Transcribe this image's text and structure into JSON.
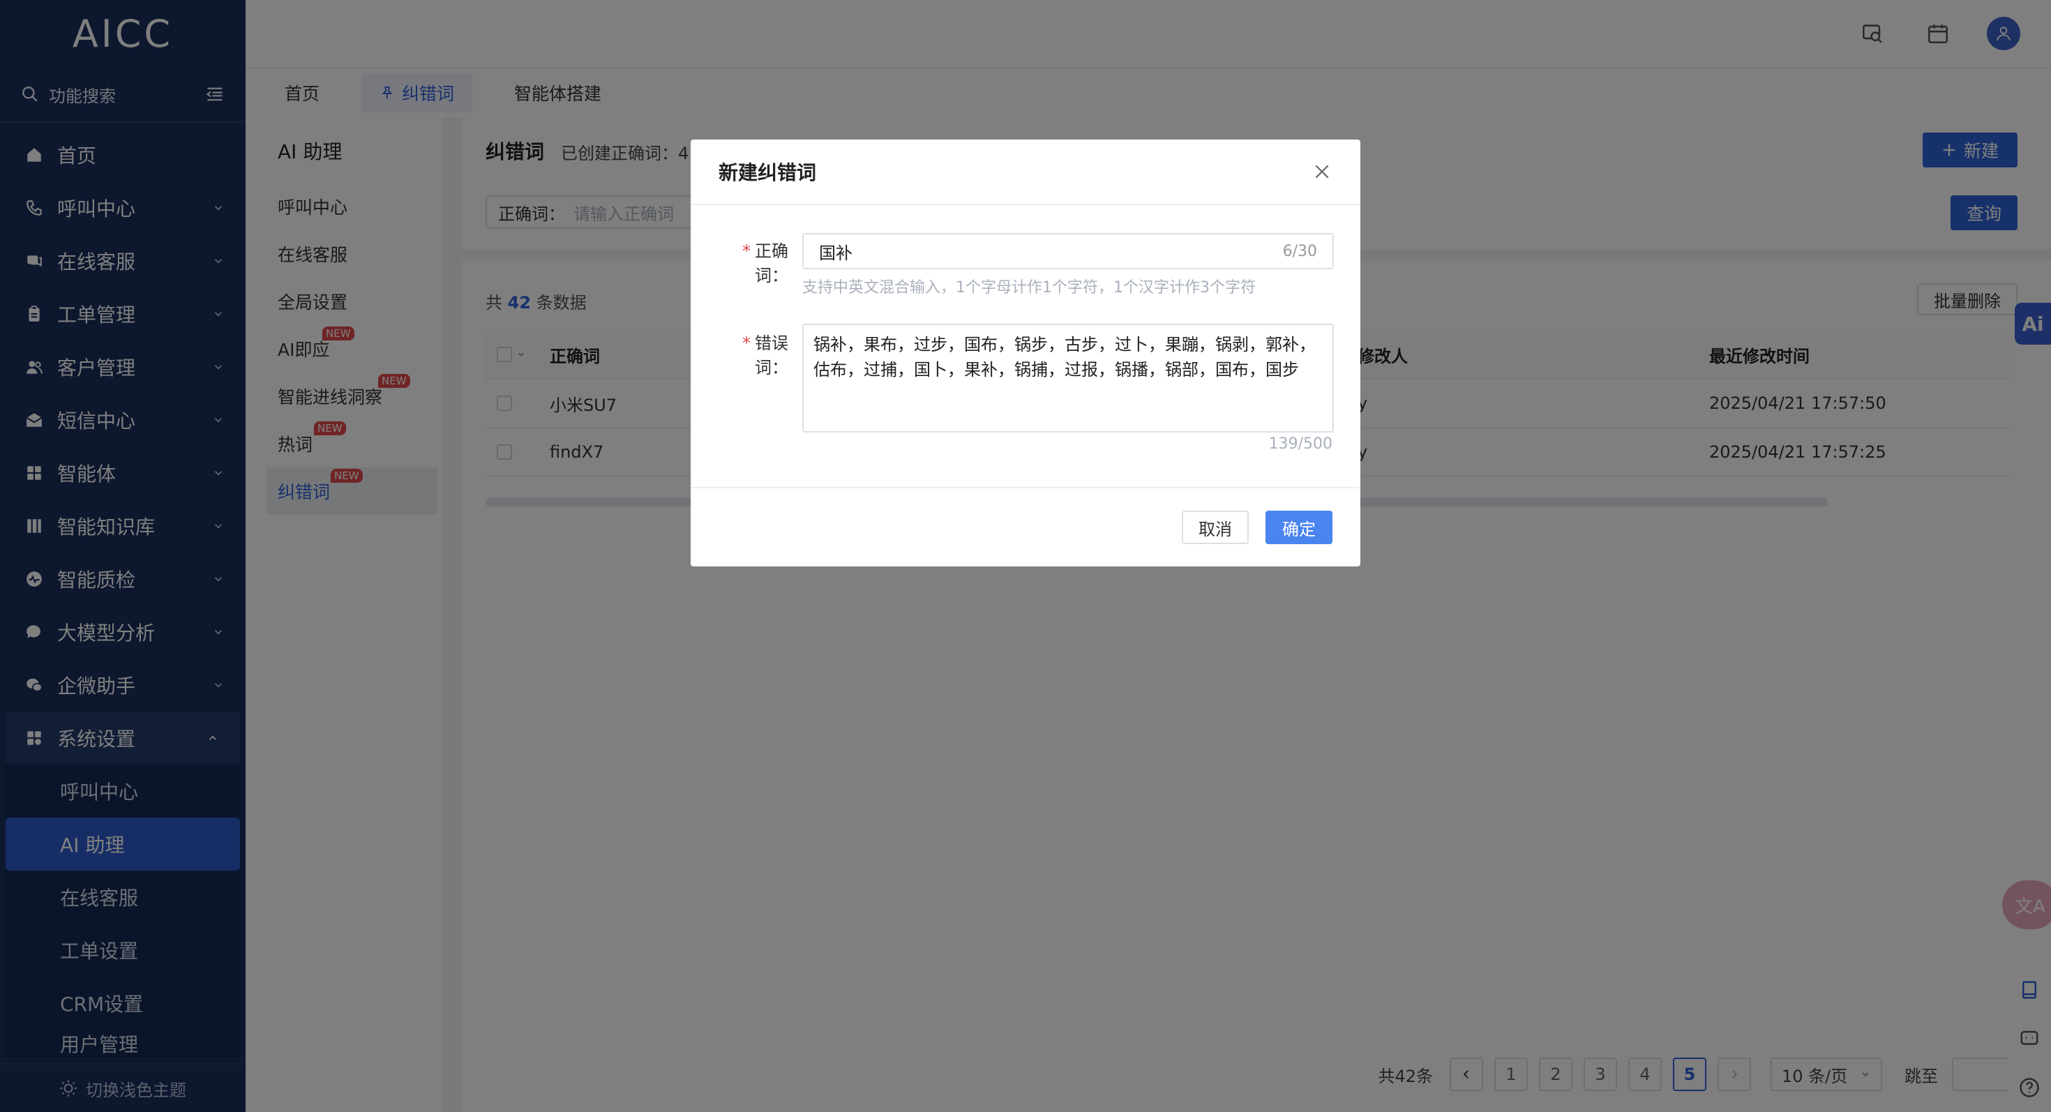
{
  "app": {
    "logo": "AICC",
    "search_label": "功能搜索",
    "theme_toggle": "切换浅色主题"
  },
  "sidebar": {
    "items": [
      {
        "label": "首页",
        "icon": "home-icon"
      },
      {
        "label": "呼叫中心",
        "icon": "phone-icon"
      },
      {
        "label": "在线客服",
        "icon": "chat-icon"
      },
      {
        "label": "工单管理",
        "icon": "clipboard-icon"
      },
      {
        "label": "客户管理",
        "icon": "users-icon"
      },
      {
        "label": "短信中心",
        "icon": "mail-icon"
      },
      {
        "label": "智能体",
        "icon": "grid-icon"
      },
      {
        "label": "智能知识库",
        "icon": "library-icon"
      },
      {
        "label": "智能质检",
        "icon": "pulse-icon"
      },
      {
        "label": "大模型分析",
        "icon": "bubble-icon"
      },
      {
        "label": "企微助手",
        "icon": "wechat-icon"
      },
      {
        "label": "系统设置",
        "icon": "apps-icon"
      }
    ],
    "sub_items": [
      "呼叫中心",
      "AI 助理",
      "在线客服",
      "工单设置",
      "CRM设置",
      "用户管理"
    ]
  },
  "tabs": [
    {
      "label": "首页"
    },
    {
      "label": "纠错词"
    },
    {
      "label": "智能体搭建"
    }
  ],
  "subpanel": {
    "title": "AI 助理",
    "items": [
      {
        "label": "呼叫中心",
        "badge": ""
      },
      {
        "label": "在线客服",
        "badge": ""
      },
      {
        "label": "全局设置",
        "badge": ""
      },
      {
        "label": "AI即应",
        "badge": "NEW"
      },
      {
        "label": "智能进线洞察",
        "badge": "NEW"
      },
      {
        "label": "热词",
        "badge": "NEW"
      },
      {
        "label": "纠错词",
        "badge": "NEW"
      }
    ]
  },
  "main": {
    "title": "纠错词",
    "created_meta": "已创建正确词：4",
    "new_button": "新建",
    "filter_label": "正确词：",
    "filter_placeholder": "请输入正确词",
    "query_button": "查询",
    "total_prefix": "共",
    "total_count": "42",
    "total_suffix": "条数据",
    "batch_delete": "批量删除",
    "columns": [
      "正确词",
      "修改人",
      "最近修改时间"
    ],
    "rows": [
      {
        "word": "小米SU7",
        "modifier": "y",
        "time": "2025/04/21 17:57:50"
      },
      {
        "word": "findX7",
        "modifier": "y",
        "time": "2025/04/21 17:57:25"
      }
    ]
  },
  "pagination": {
    "total": "共42条",
    "pages": [
      "1",
      "2",
      "3",
      "4",
      "5"
    ],
    "current": "5",
    "page_size": "10 条/页",
    "jump_label": "跳至"
  },
  "modal": {
    "title": "新建纠错词",
    "correct_label": "正确词：",
    "correct_value": "国补",
    "correct_count": "6/30",
    "hint": "支持中英文混合输入，1个字母计作1个字符，1个汉字计作3个字符",
    "wrong_label": "错误词：",
    "wrong_value": "锅补，果布，过步，国布，锅步，古步，过卜，果蹦，锅剥，郭补，估布，过捕，国卜，果补，锅捕，过报，锅播，锅部，国布，国步",
    "wrong_count": "139/500",
    "cancel": "取消",
    "ok": "确定"
  },
  "colors": {
    "sidebar": "#1b2f5c",
    "accent": "#2f63d8",
    "overlay": "rgba(0,0,0,0.5)"
  }
}
